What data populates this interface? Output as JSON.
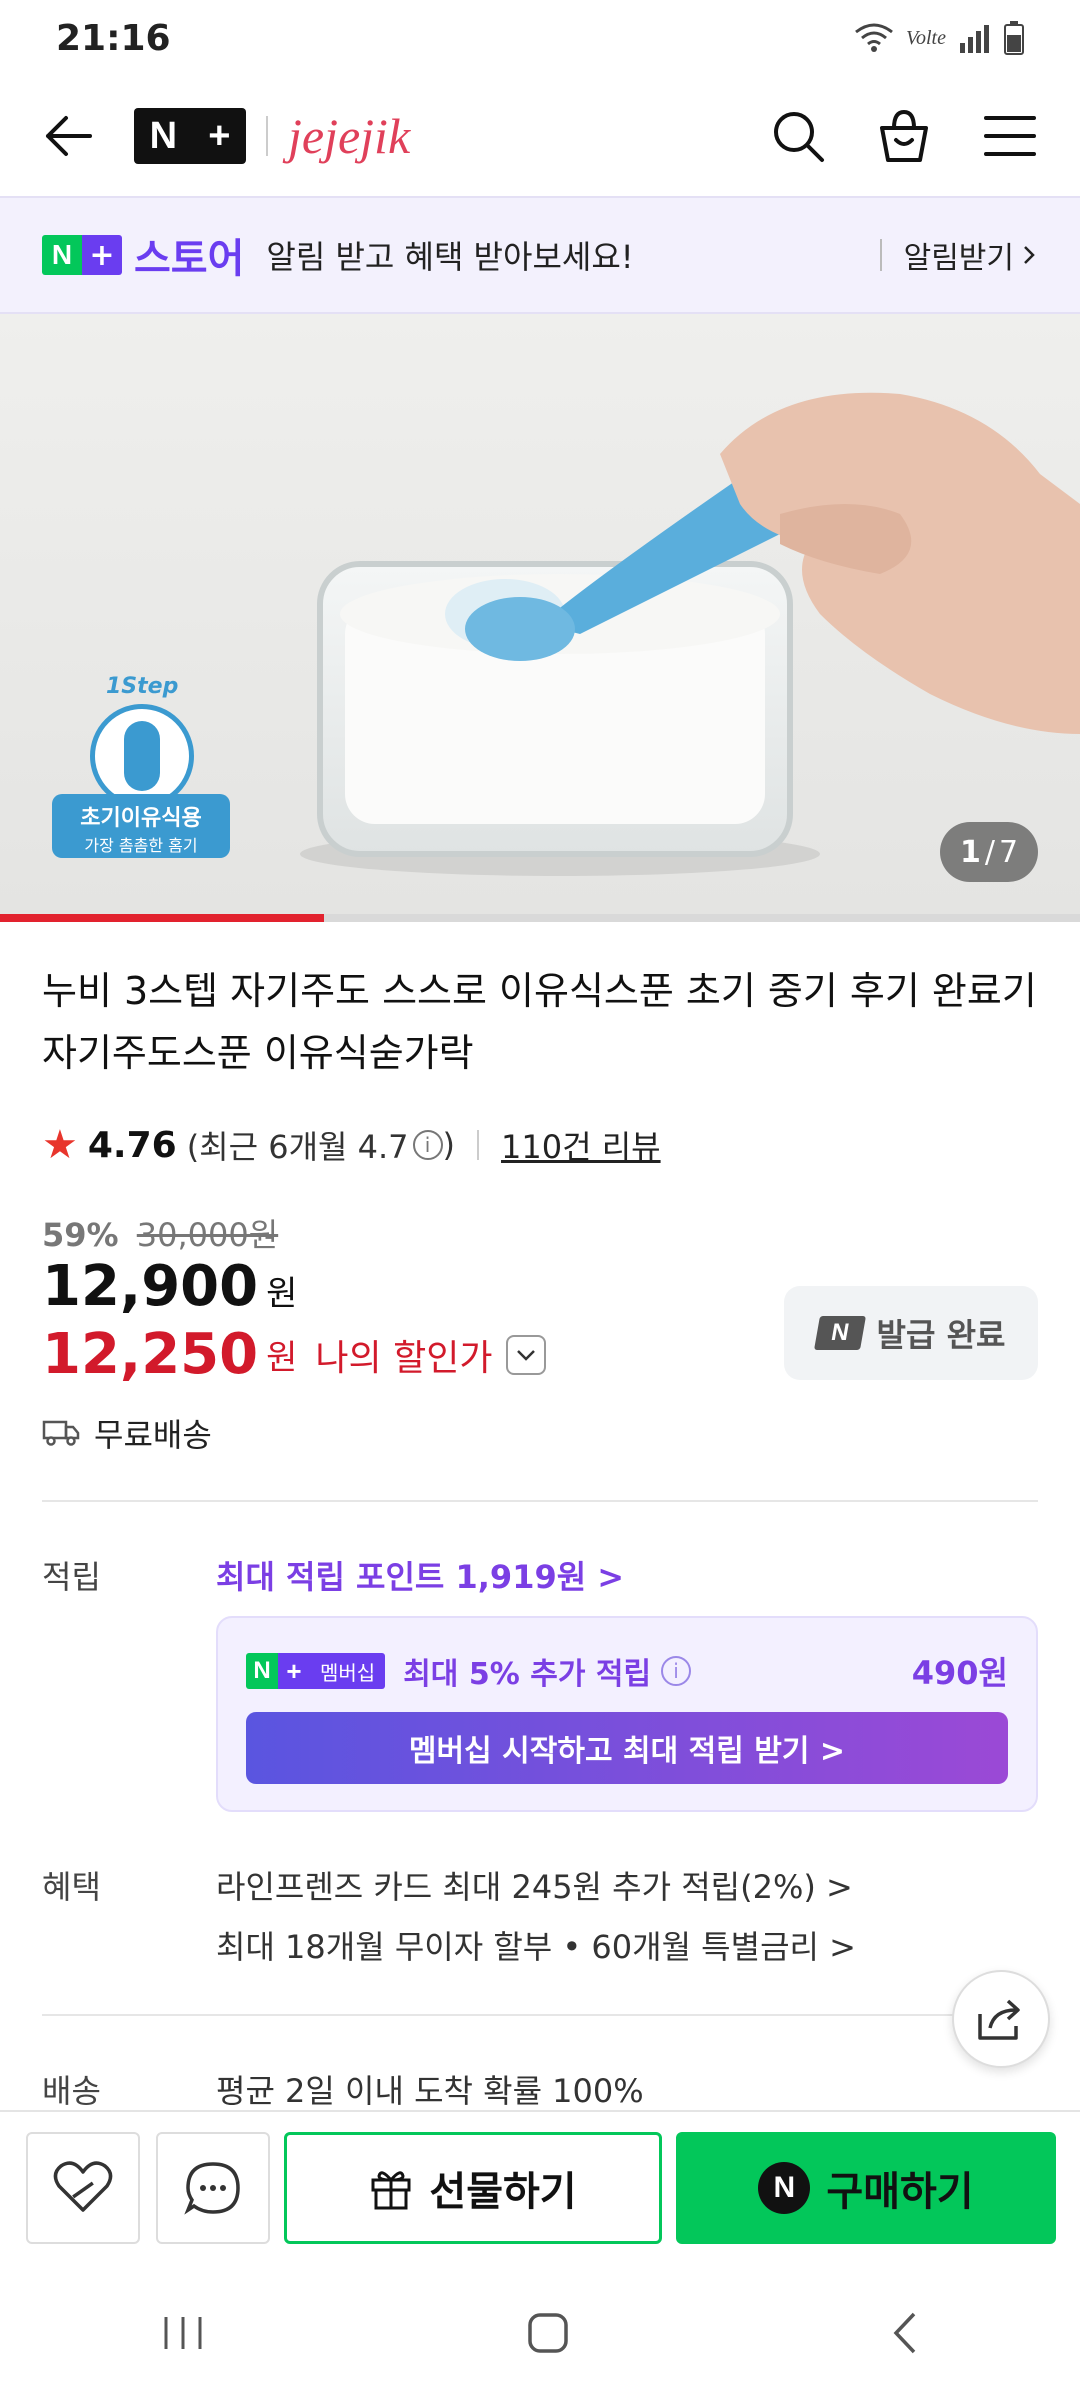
{
  "status_bar": {
    "time": "21:16",
    "network": "Volte"
  },
  "header": {
    "brand": "jejejik",
    "nplus_n": "N",
    "nplus_plus": "+"
  },
  "store_banner": {
    "badge_n": "N",
    "badge_plus": "+",
    "store_label": "스토어",
    "message": "알림 받고 혜택 받아보세요!",
    "alarm_label": "알림받기"
  },
  "hero": {
    "badge_step": "1Step",
    "badge_title": "초기이유식용",
    "badge_sub": "가장 촘촘한 홈기",
    "current_index": "1",
    "total": "7",
    "progress_fraction": 0.3
  },
  "product": {
    "title": "누비 3스텝 자기주도 스스로 이유식스푼 초기 중기 후기 완료기 자기주도스푼 이유식숟가락",
    "rating": "4.76",
    "recent_rating_prefix": "(최근 6개월 4.7",
    "recent_rating_suffix": ")",
    "review_count": "110건 리뷰",
    "discount_pct": "59%",
    "original_price": "30,000원",
    "price": "12,900",
    "currency": "원",
    "my_price": "12,250",
    "my_price_label": "나의 할인가",
    "issued_label": "발급 완료",
    "issued_n": "N",
    "delivery": "무료배송"
  },
  "points": {
    "label": "적립",
    "max_points": "최대 적립 포인트 1,919원 >",
    "membership_badge": "멤버십",
    "membership_text": "최대 5% 추가 적립",
    "membership_amount": "490원",
    "cta": "멤버십 시작하고 최대 적립 받기 >"
  },
  "benefits": {
    "label": "혜택",
    "items": [
      "라인프렌즈 카드 최대 245원 추가 적립(2%) >",
      "최대 18개월 무이자 할부 • 60개월 특별금리 >"
    ]
  },
  "shipping": {
    "label": "배송",
    "text": "평균 2일 이내 도착 확률 100%"
  },
  "actions": {
    "gift": "선물하기",
    "buy": "구매하기",
    "buy_n": "N"
  },
  "colors": {
    "naver_green": "#03c75a",
    "purple": "#7b3fe4",
    "price_red": "#d21a2b"
  }
}
